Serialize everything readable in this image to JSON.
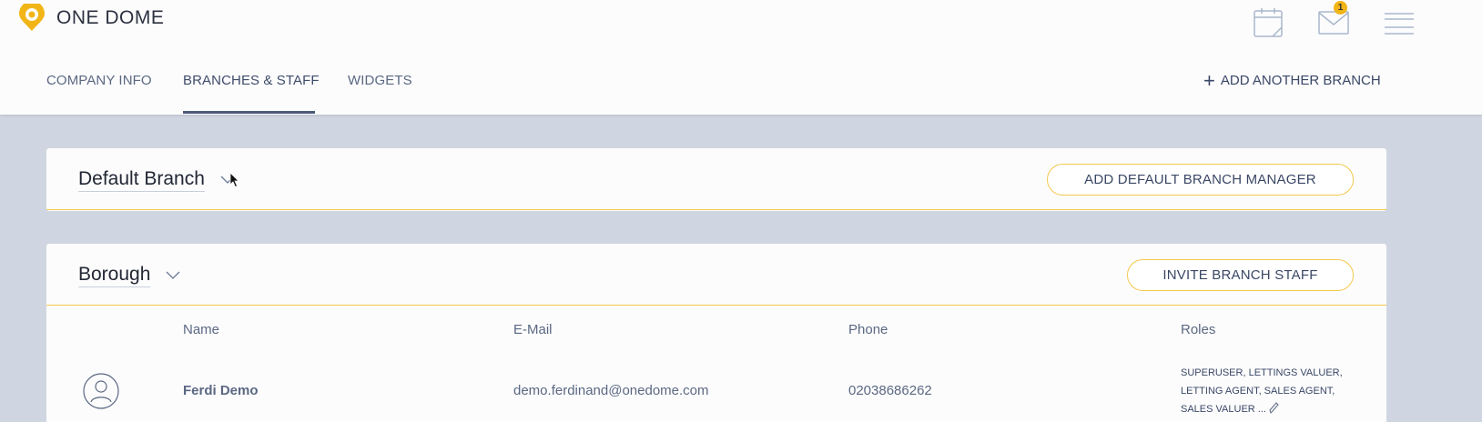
{
  "app": {
    "brand": "ONE DOME",
    "accent": "#f2b517"
  },
  "header": {
    "icons": [
      "calendar-icon",
      "mail-icon",
      "menu-icon"
    ],
    "mail_badge": "1"
  },
  "tabs": [
    {
      "label": "COMPANY INFO",
      "active": false
    },
    {
      "label": "BRANCHES & STAFF",
      "active": true
    },
    {
      "label": "WIDGETS",
      "active": false
    }
  ],
  "add_branch_label": "ADD ANOTHER BRANCH",
  "branches": [
    {
      "name": "Default Branch",
      "action_label": "ADD DEFAULT BRANCH MANAGER"
    },
    {
      "name": "Borough",
      "action_label": "INVITE BRANCH STAFF"
    }
  ],
  "staff_table": {
    "columns": [
      "Name",
      "E-Mail",
      "Phone",
      "Roles"
    ],
    "rows": [
      {
        "name": "Ferdi Demo",
        "email": "demo.ferdinand@onedome.com",
        "phone": "02038686262",
        "roles_line1": "SUPERUSER, LETTINGS VALUER,",
        "roles_line2": "LETTING AGENT, SALES AGENT,",
        "roles_line3": "SALES VALUER ..."
      }
    ]
  }
}
